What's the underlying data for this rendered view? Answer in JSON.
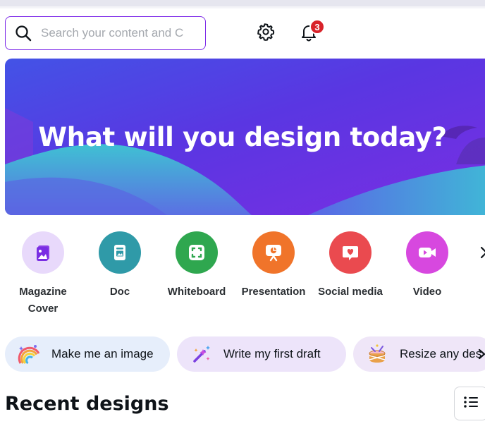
{
  "search": {
    "placeholder": "Search your content and C"
  },
  "notifications": {
    "count": "3"
  },
  "hero": {
    "title": "What will you design today?"
  },
  "categories": [
    {
      "label_line1": "Magazine",
      "label_line2": "Cover",
      "icon": "magazine-cover-icon",
      "color": "#e8d9fb"
    },
    {
      "label_line1": "Doc",
      "label_line2": "",
      "icon": "doc-icon",
      "color": "#2f9aa8"
    },
    {
      "label_line1": "Whiteboard",
      "label_line2": "",
      "icon": "whiteboard-icon",
      "color": "#2fa74f"
    },
    {
      "label_line1": "Presentation",
      "label_line2": "",
      "icon": "presentation-icon",
      "color": "#f0742a"
    },
    {
      "label_line1": "Social media",
      "label_line2": "",
      "icon": "social-media-icon",
      "color": "#ea4a4f"
    },
    {
      "label_line1": "Video",
      "label_line2": "",
      "icon": "video-icon",
      "color": "#d748df"
    }
  ],
  "chips": [
    {
      "label": "Make me an image",
      "icon": "rainbow-icon",
      "color": "#e6eefb"
    },
    {
      "label": "Write my first draft",
      "icon": "magic-wand-icon",
      "color": "#ede4fa"
    },
    {
      "label": "Resize any des",
      "icon": "resize-drum-icon",
      "color": "#efe6f8"
    }
  ],
  "recent": {
    "title": "Recent designs"
  }
}
